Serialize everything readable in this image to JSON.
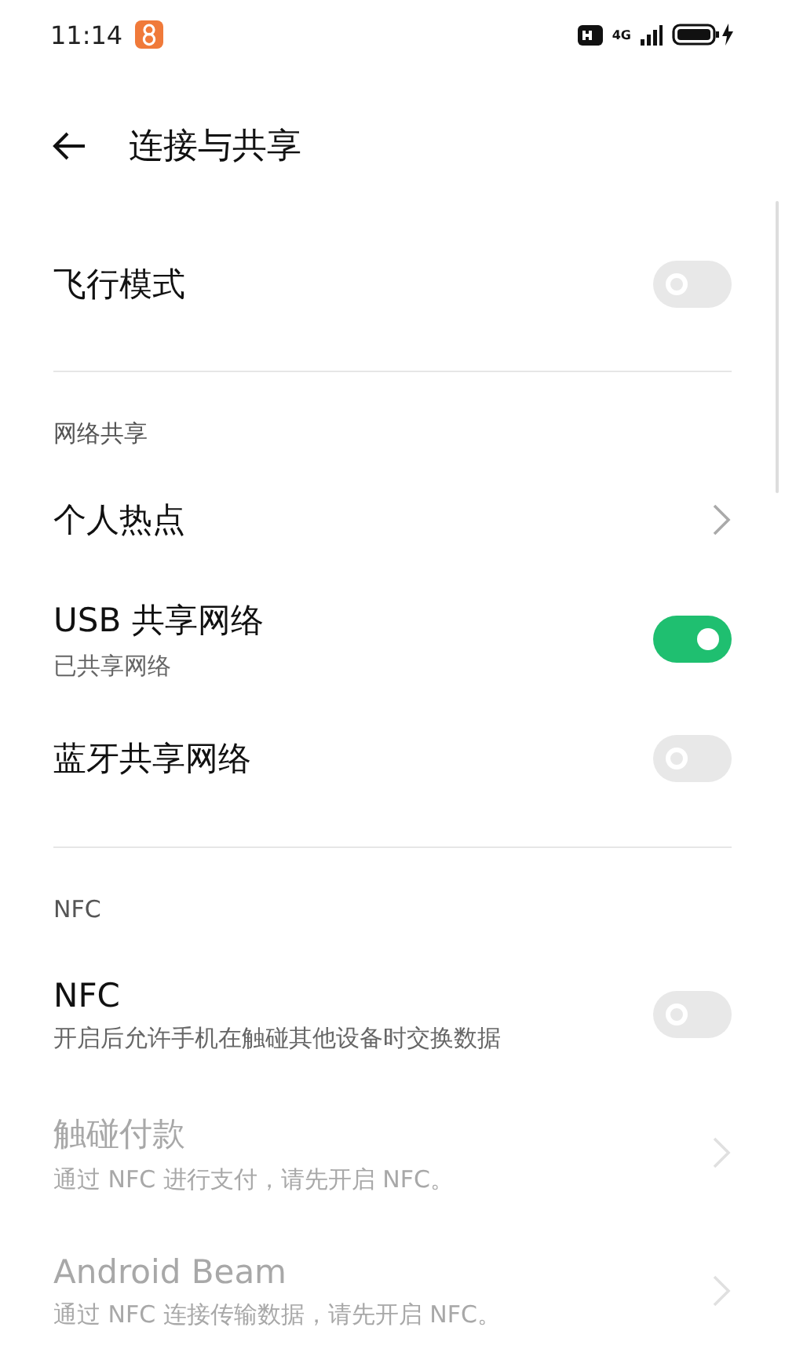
{
  "status_bar": {
    "time": "11:14",
    "network": "4G"
  },
  "header": {
    "title": "连接与共享"
  },
  "sections": [
    {
      "items": [
        {
          "kind": "toggle",
          "title": "飞行模式",
          "on": false,
          "disabled": false
        }
      ]
    },
    {
      "title": "网络共享",
      "items": [
        {
          "kind": "link",
          "title": "个人热点",
          "disabled": false
        },
        {
          "kind": "toggle",
          "title": "USB 共享网络",
          "subtitle": "已共享网络",
          "on": true,
          "disabled": false
        },
        {
          "kind": "toggle",
          "title": "蓝牙共享网络",
          "on": false,
          "disabled": false
        }
      ]
    },
    {
      "title": "NFC",
      "items": [
        {
          "kind": "toggle",
          "title": "NFC",
          "subtitle": "开启后允许手机在触碰其他设备时交换数据",
          "on": false,
          "disabled": false
        },
        {
          "kind": "link",
          "title": "触碰付款",
          "subtitle": "通过 NFC 进行支付，请先开启 NFC。",
          "disabled": true
        },
        {
          "kind": "link",
          "title": "Android Beam",
          "subtitle": "通过 NFC 连接传输数据，请先开启 NFC。",
          "disabled": true
        }
      ]
    }
  ]
}
